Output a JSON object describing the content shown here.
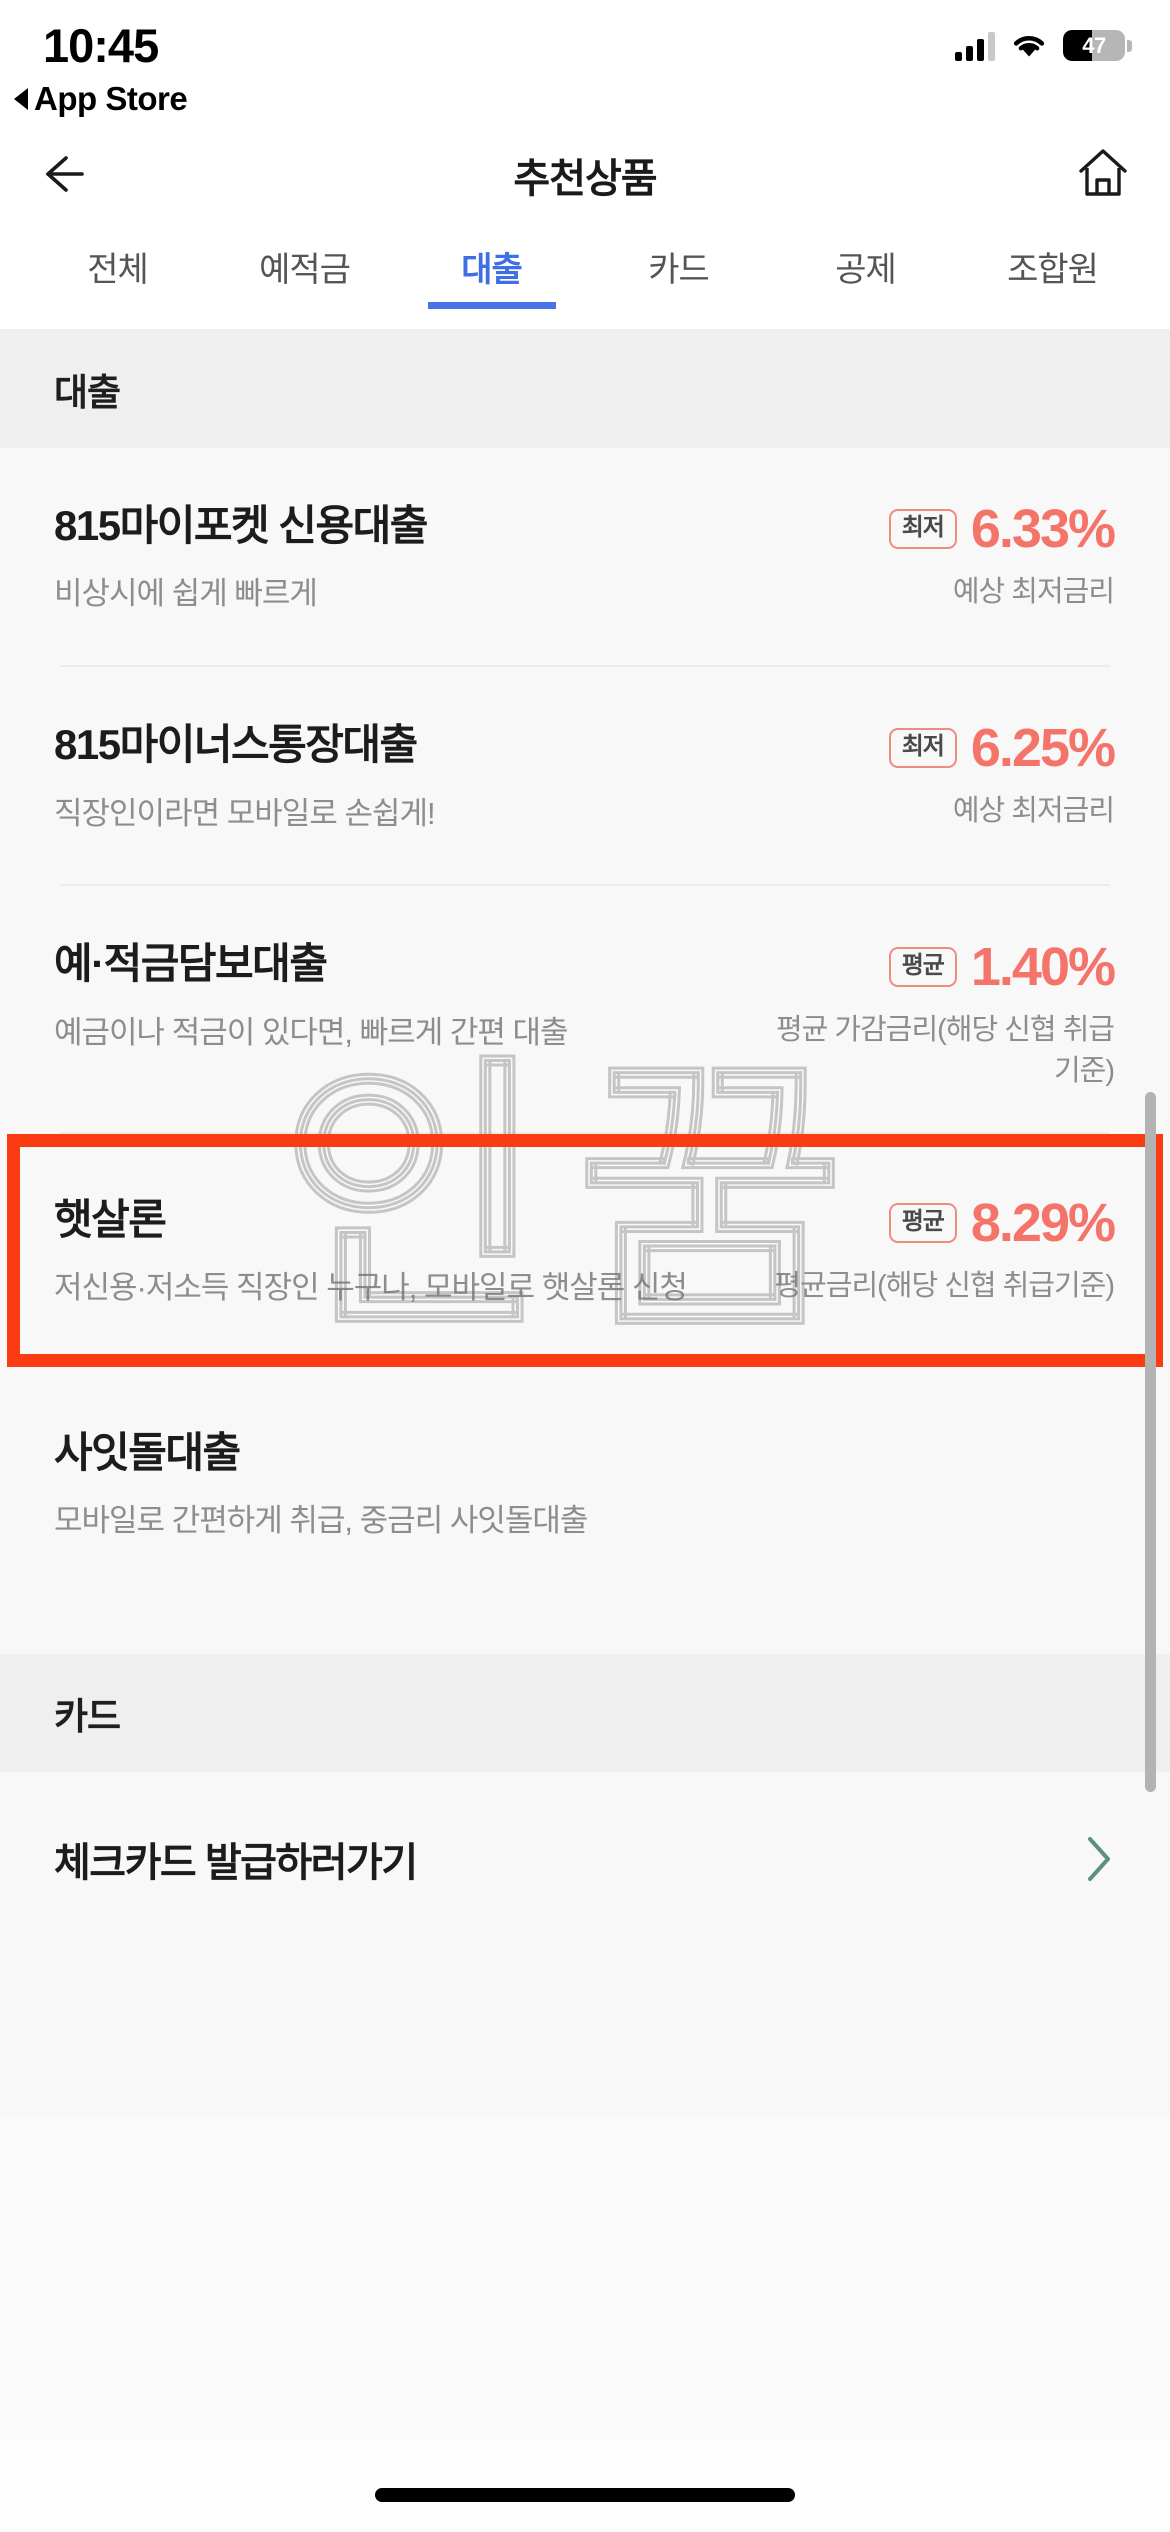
{
  "status_bar": {
    "time": "10:45",
    "back_app_label": "App Store",
    "battery_level": "47",
    "signal_icon": "cellular-signal-icon",
    "wifi_icon": "wifi-icon"
  },
  "nav": {
    "title": "추천상품",
    "back_icon": "back-arrow-icon",
    "home_icon": "home-icon"
  },
  "tabs": [
    {
      "label": "전체",
      "active": false
    },
    {
      "label": "예적금",
      "active": false
    },
    {
      "label": "대출",
      "active": true
    },
    {
      "label": "카드",
      "active": false
    },
    {
      "label": "공제",
      "active": false
    },
    {
      "label": "조합원",
      "active": false
    }
  ],
  "watermark": {
    "text": "인꿈"
  },
  "sections": [
    {
      "header": "대출",
      "items": [
        {
          "name": "815마이포켓 신용대출",
          "desc": "비상시에 쉽게 빠르게",
          "rate_badge": "최저",
          "rate_value": "6.33%",
          "rate_note": "예상 최저금리",
          "highlighted": false
        },
        {
          "name": "815마이너스통장대출",
          "desc": "직장인이라면 모바일로 손쉽게!",
          "rate_badge": "최저",
          "rate_value": "6.25%",
          "rate_note": "예상 최저금리",
          "highlighted": false
        },
        {
          "name": "예·적금담보대출",
          "desc": "예금이나 적금이 있다면, 빠르게 간편 대출",
          "rate_badge": "평균",
          "rate_value": "1.40%",
          "rate_note": "평균 가감금리(해당 신협 취급기준)",
          "highlighted": false
        },
        {
          "name": "햇살론",
          "desc": "저신용·저소득 직장인 누구나, 모바일로 햇살론 신청",
          "rate_badge": "평균",
          "rate_value": "8.29%",
          "rate_note": "평균금리(해당 신협 취급기준)",
          "highlighted": true
        },
        {
          "name": "사잇돌대출",
          "desc": "모바일로 간편하게 취급, 중금리 사잇돌대출",
          "rate_badge": "",
          "rate_value": "",
          "rate_note": "",
          "highlighted": false
        }
      ]
    },
    {
      "header": "카드",
      "links": [
        {
          "label": "체크카드 발급하러가기",
          "chevron_icon": "chevron-right-icon"
        }
      ]
    }
  ],
  "colors": {
    "accent_blue": "#4a72e8",
    "rate_red": "#f4746a",
    "highlight_orange": "#fb3b12",
    "chevron_teal": "#5f8f80",
    "section_bg": "#efefef",
    "page_bg": "#f8f8f8"
  }
}
